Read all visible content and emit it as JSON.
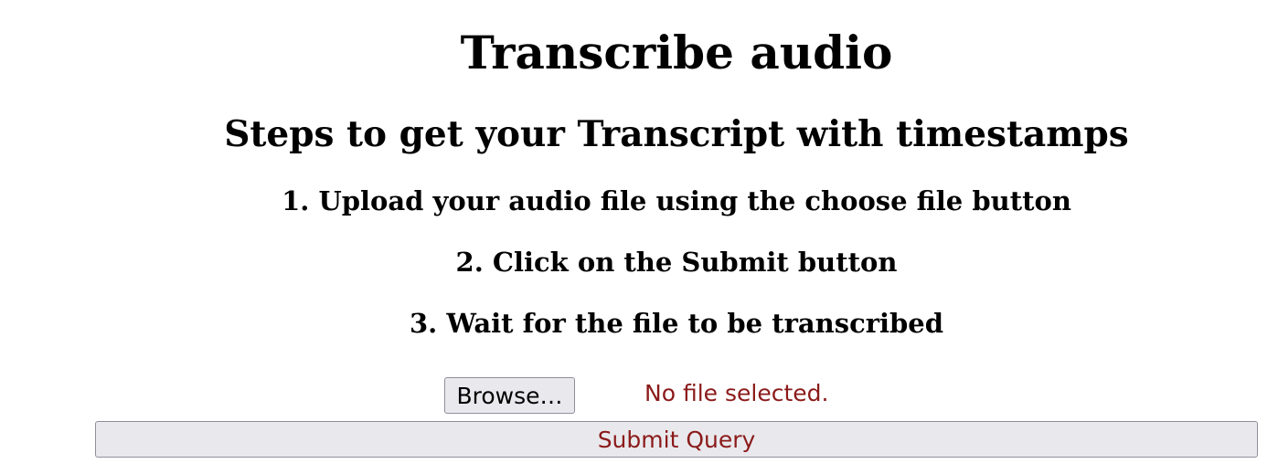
{
  "page": {
    "title": "Transcribe audio",
    "subtitle": "Steps to get your Transcript with timestamps",
    "steps": [
      "1. Upload your audio file using the choose file button",
      "2. Click on the Submit button",
      "3. Wait for the file to be transcribed"
    ]
  },
  "form": {
    "browse_label": "Browse…",
    "file_status": "No file selected.",
    "submit_label": "Submit Query"
  },
  "colors": {
    "accent_text": "#8b1a1a",
    "button_bg": "#e9e9ed"
  }
}
